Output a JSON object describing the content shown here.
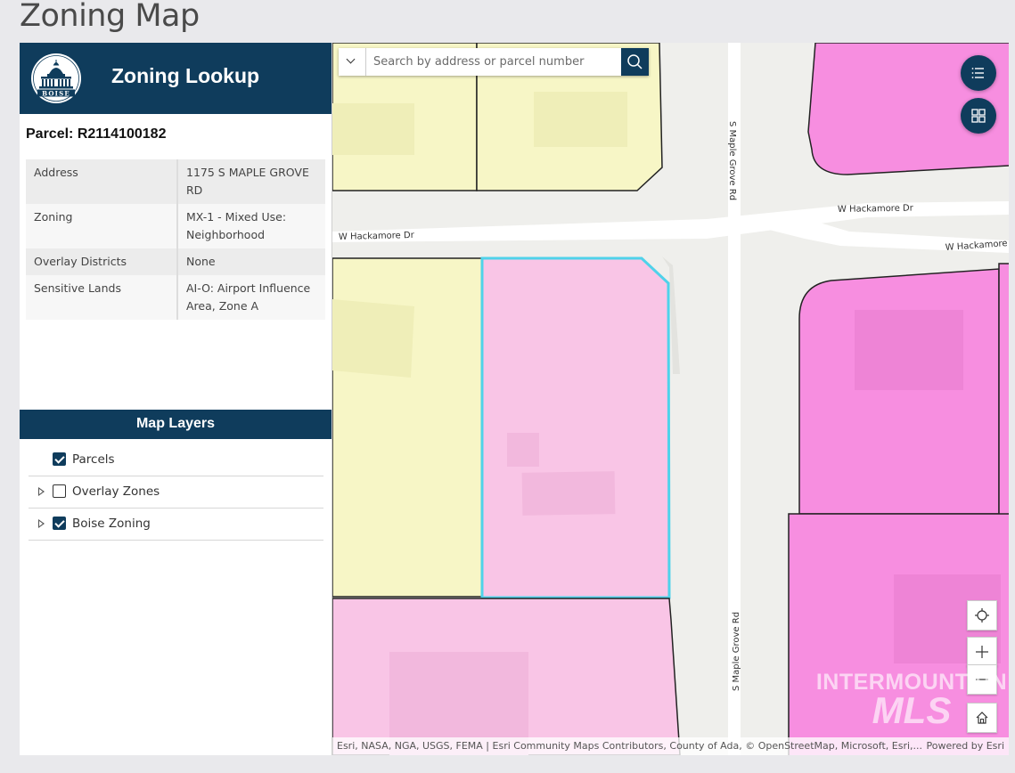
{
  "page_title": "Zoning Map",
  "header": {
    "title": "Zoning Lookup",
    "logo_text": "BOISE"
  },
  "parcel": {
    "title": "Parcel: R2114100182",
    "attributes": [
      {
        "key": "Address",
        "value": "1175 S MAPLE GROVE RD"
      },
      {
        "key": "Zoning",
        "value": "MX-1 - Mixed Use: Neighborhood"
      },
      {
        "key": "Overlay Districts",
        "value": "None"
      },
      {
        "key": "Sensitive Lands",
        "value": "AI-O: Airport Influence Area, Zone A"
      }
    ]
  },
  "layers": {
    "title": "Map Layers",
    "items": [
      {
        "label": "Parcels",
        "checked": true,
        "expandable": false
      },
      {
        "label": "Overlay Zones",
        "checked": false,
        "expandable": true
      },
      {
        "label": "Boise Zoning",
        "checked": true,
        "expandable": true
      }
    ]
  },
  "search": {
    "placeholder": "Search by address or parcel number"
  },
  "map": {
    "streets": {
      "hackamore_west": "W Hackamore Dr",
      "hackamore_east_top": "W Hackamore Dr",
      "hackamore_east_bottom": "W Hackamore",
      "maple_grove_top": "S Maple Grove Rd",
      "maple_grove_bottom": "S Maple Grove Rd"
    },
    "colors": {
      "header": "#0f3c5c",
      "zone_yellow": "#f7f6c6",
      "zone_light_pink": "#f9c5e6",
      "zone_magenta": "#f78ee0",
      "selected_outline": "#4fd2ea"
    },
    "attribution": "Esri, NASA, NGA, USGS, FEMA | Esri Community Maps Contributors, County of Ada, © OpenStreetMap, Microsoft, Esri,...",
    "powered_by": "Powered by Esri"
  },
  "watermark": {
    "line1": "INTERMOUNTAIN",
    "line2": "MLS"
  },
  "icons": {
    "search": "search-icon",
    "legend": "list-icon",
    "basemap": "grid-icon",
    "locate": "crosshair-icon",
    "zoom_in": "plus-icon",
    "zoom_out": "minus-icon",
    "home": "home-icon"
  }
}
